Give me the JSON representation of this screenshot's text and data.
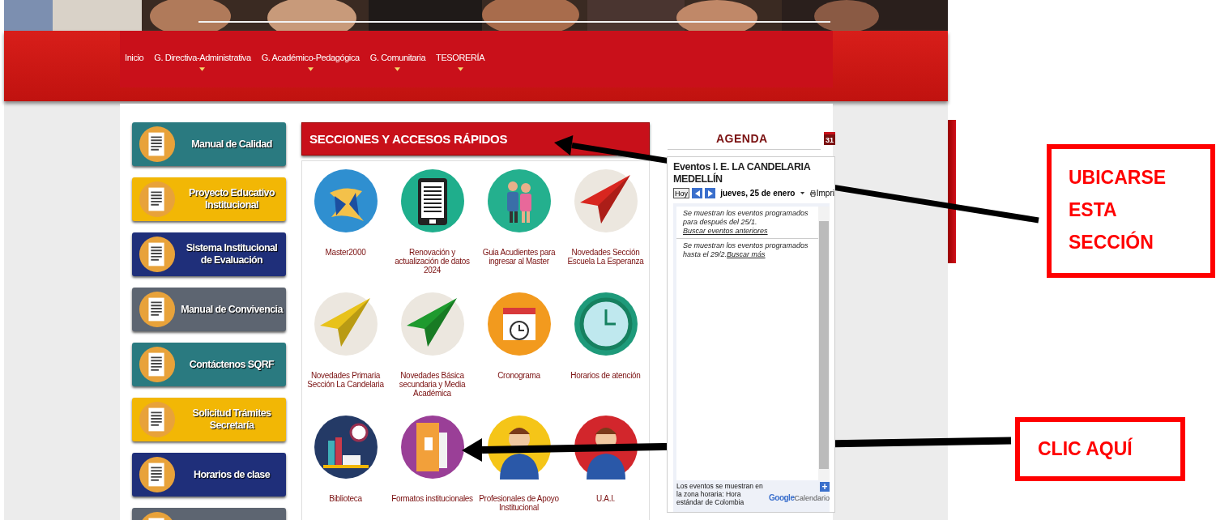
{
  "nav": [
    {
      "label": "Inicio",
      "dropdown": false
    },
    {
      "label": "G. Directiva-Administrativa",
      "dropdown": true
    },
    {
      "label": "G. Académico-Pedagógica",
      "dropdown": true
    },
    {
      "label": "G. Comunitaria",
      "dropdown": true
    },
    {
      "label": "TESORERÍA",
      "dropdown": true
    }
  ],
  "sidebar": [
    {
      "label": "Manual de Calidad",
      "color": "#2a7a80"
    },
    {
      "label": "Proyecto Educativo Institucional",
      "color": "#f2b705"
    },
    {
      "label": "Sistema Institucional de Evaluación",
      "color": "#1f2f7a"
    },
    {
      "label": "Manual de Convivencia",
      "color": "#5d6571"
    },
    {
      "label": "Contáctenos SQRF",
      "color": "#2a7a80"
    },
    {
      "label": "Solicitud Trámites Secretaría",
      "color": "#f2b705"
    },
    {
      "label": "Horarios de clase",
      "color": "#1f2f7a"
    },
    {
      "color": "#5d6571"
    }
  ],
  "sections": {
    "title": "SECCIONES Y ACCESOS RÁPIDOS",
    "tiles": [
      {
        "label": "Master2000",
        "kind": "logo",
        "color": "#2f8fd0"
      },
      {
        "label": "Renovación y actualización de datos 2024",
        "kind": "tablet",
        "color": "#1fae8c"
      },
      {
        "label": "Guia Acudientes para ingresar al Master",
        "kind": "family",
        "color": "#24b08e"
      },
      {
        "label": "Novedades Sección Escuela La Esperanza",
        "kind": "plane",
        "color": "#d8261f"
      },
      {
        "label": "Novedades Primaria Sección La Candelaria",
        "kind": "plane",
        "color": "#e8c21a"
      },
      {
        "label": "Novedades Básica secundaria y Media Académica",
        "kind": "plane",
        "color": "#1e9a2e"
      },
      {
        "label": "Cronograma",
        "kind": "calendar",
        "color": "#f29a1e"
      },
      {
        "label": "Horarios de atención",
        "kind": "clock",
        "color": "#1e9a7a"
      },
      {
        "label": "Biblioteca",
        "kind": "books",
        "color": "#243a66"
      },
      {
        "label": "Formatos institucionales",
        "kind": "folder",
        "color": "#9a3f97"
      },
      {
        "label": "Profesionales de Apoyo Institucional",
        "kind": "person",
        "color": "#f5c518"
      },
      {
        "label": "U.A.I.",
        "kind": "person",
        "color": "#d2262c"
      }
    ]
  },
  "agenda": {
    "title": "AGENDA",
    "calendar_icon": "31",
    "calendar": {
      "title": "Eventos I. E. LA CANDELARIA MEDELLÍN",
      "today": "Hoy",
      "date": "jueves, 25 de enero",
      "print": "Impri",
      "notices": [
        {
          "text": "Se muestran los eventos programados para después del 25/1.",
          "link": "Buscar eventos anteriores",
          "link_break": true
        },
        {
          "text": "Se muestran los eventos programados hasta el 29/2.",
          "link": "Buscar más",
          "link_break": false
        }
      ],
      "footer": "Los eventos se muestran en la zona horaria: Hora estándar de Colombia",
      "add": "+",
      "brand": "Google",
      "product": "Calendario"
    }
  },
  "annotations": [
    {
      "text": "UBICARSE ESTA SECCIÓN",
      "kind": "section"
    },
    {
      "text": "CLIC AQUÍ",
      "kind": "click"
    }
  ]
}
